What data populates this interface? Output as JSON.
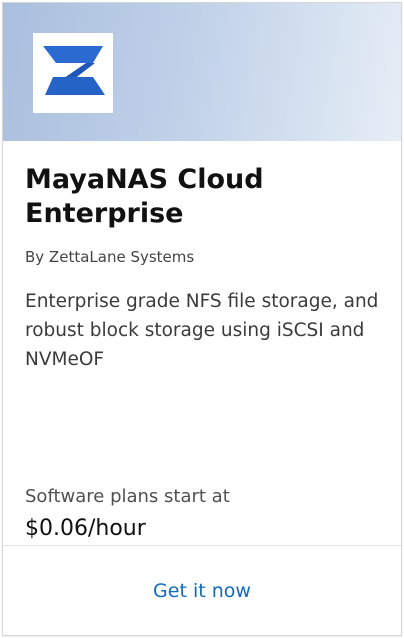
{
  "card": {
    "logo_icon": "zettalane-z-logo-icon",
    "title": "MayaNAS Cloud Enterprise",
    "publisher": "By ZettaLane Systems",
    "description": "Enterprise grade NFS file storage, and robust block storage using iSCSI and NVMeOF",
    "pricing_label": "Software plans start at",
    "price": "$0.06/hour",
    "cta_label": "Get it now"
  },
  "colors": {
    "logo_blue": "#2563c7",
    "link": "#0f6cbd",
    "header_gradient_start": "#aabfde",
    "header_gradient_end": "#e6edf6"
  }
}
